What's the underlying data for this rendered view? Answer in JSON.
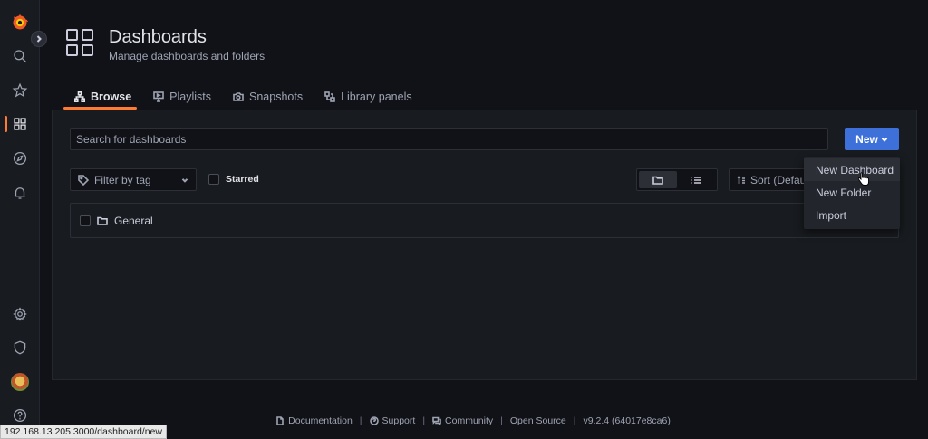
{
  "sidebar": {
    "logo": "grafana-logo-icon",
    "items": [
      {
        "name": "search-icon"
      },
      {
        "name": "star-icon"
      },
      {
        "name": "dashboards-icon",
        "active": true
      },
      {
        "name": "compass-icon"
      },
      {
        "name": "bell-icon"
      }
    ],
    "bottom_items": [
      {
        "name": "gear-icon"
      },
      {
        "name": "shield-icon"
      },
      {
        "name": "avatar"
      },
      {
        "name": "help-icon"
      }
    ]
  },
  "header": {
    "title": "Dashboards",
    "subtitle": "Manage dashboards and folders"
  },
  "tabs": [
    {
      "label": "Browse",
      "icon": "sitemap-icon",
      "active": true
    },
    {
      "label": "Playlists",
      "icon": "presentation-icon"
    },
    {
      "label": "Snapshots",
      "icon": "camera-icon"
    },
    {
      "label": "Library panels",
      "icon": "library-panel-icon"
    }
  ],
  "search": {
    "placeholder": "Search for dashboards",
    "value": ""
  },
  "new_button": {
    "label": "New"
  },
  "filter": {
    "placeholder": "Filter by tag"
  },
  "starred": {
    "label": "Starred",
    "checked": false
  },
  "sort": {
    "label": "Sort (Default A-Z)"
  },
  "folders": [
    {
      "label": "General"
    }
  ],
  "dropdown": {
    "items": [
      "New Dashboard",
      "New Folder",
      "Import"
    ],
    "hovered": "New Dashboard"
  },
  "footer": {
    "documentation": "Documentation",
    "support": "Support",
    "community": "Community",
    "open_source": "Open Source",
    "version": "v9.2.4 (64017e8ca6)"
  },
  "status_url": "192.168.13.205:3000/dashboard/new",
  "colors": {
    "accent": "#ff7a33",
    "primary": "#3d71d9",
    "background": "#111217",
    "panel": "#181b1f"
  }
}
